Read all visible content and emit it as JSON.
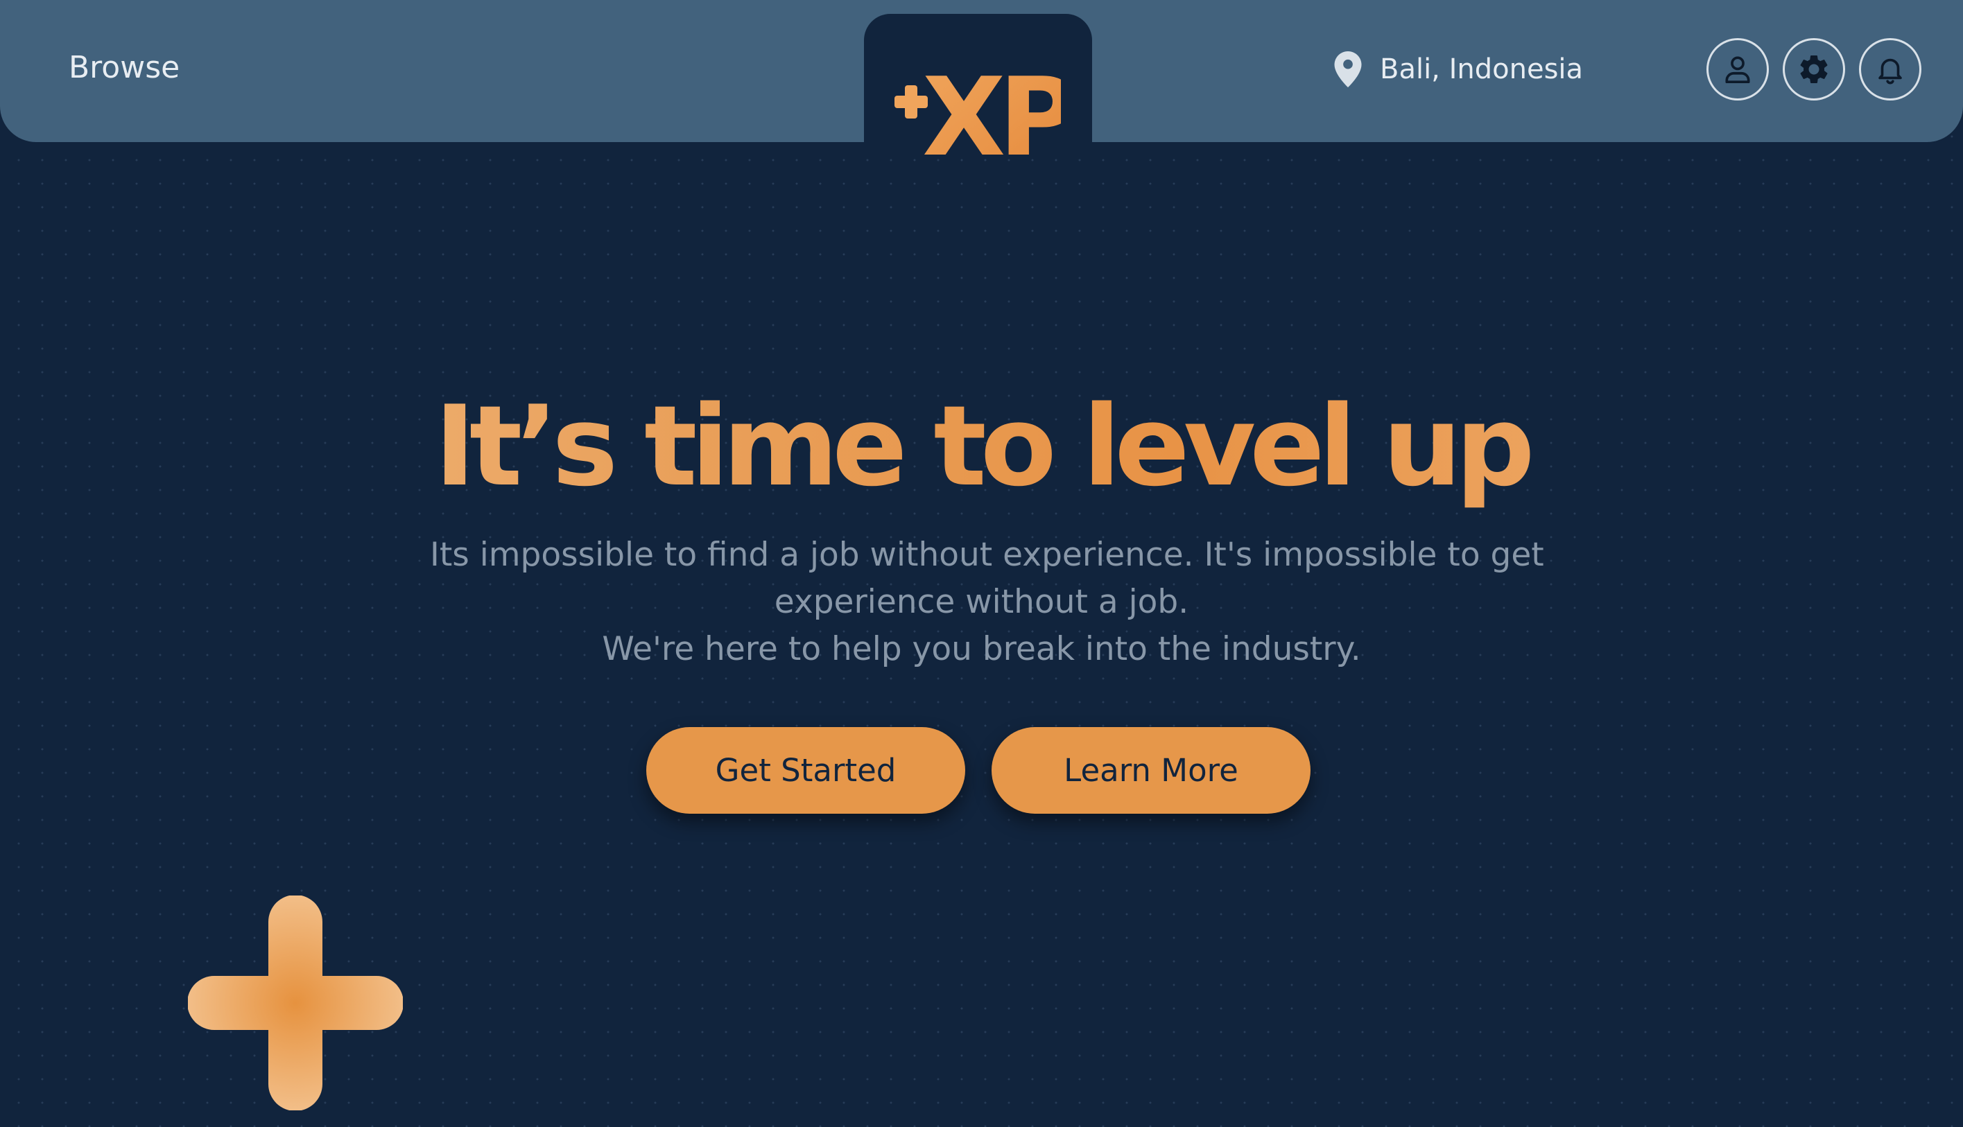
{
  "header": {
    "browse_label": "Browse",
    "logo_text": "XP",
    "location": "Bali, Indonesia",
    "icons": [
      "user-icon",
      "gear-icon",
      "bell-icon"
    ]
  },
  "hero": {
    "title": "It’s time to level up",
    "subtitle_lines": [
      "Its impossible to find a job without experience. It's impossible to get",
      "experience without a job.",
      "We're here to help you break into the industry."
    ],
    "buttons": {
      "primary": "Get Started",
      "secondary": "Learn More"
    }
  },
  "colors": {
    "background": "#11243d",
    "header": "#42627d",
    "accent": "#e6974a",
    "text_muted": "#8897a8"
  }
}
